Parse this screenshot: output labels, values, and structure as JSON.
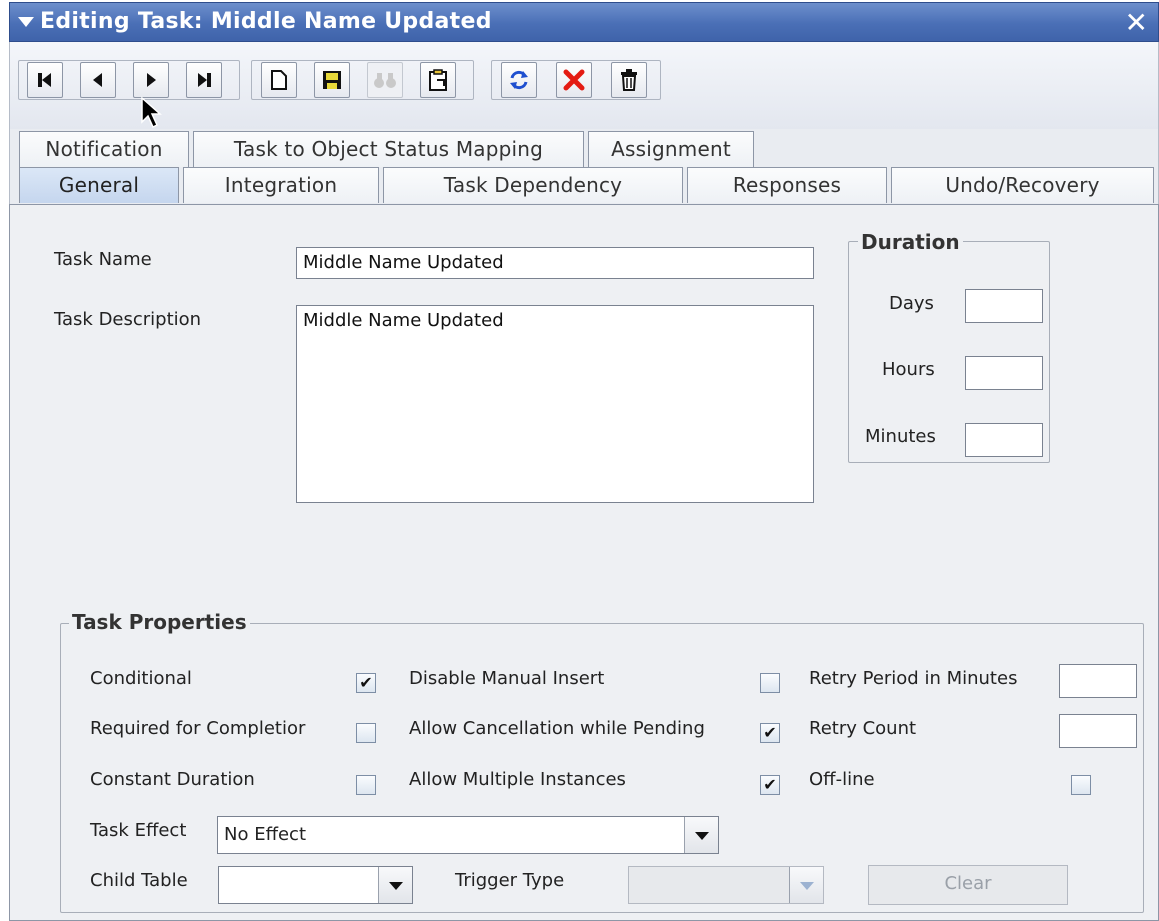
{
  "window": {
    "title": "Editing Task: Middle Name Updated"
  },
  "toolbar": {
    "buttons": [
      "first-record",
      "previous-record",
      "next-record",
      "last-record",
      "new",
      "save",
      "find",
      "query",
      "refresh",
      "delete-x",
      "trash"
    ]
  },
  "tabs_row1": [
    "Notification",
    "Task to Object Status Mapping",
    "Assignment"
  ],
  "tabs_row2": [
    "General",
    "Integration",
    "Task Dependency",
    "Responses",
    "Undo/Recovery"
  ],
  "general": {
    "task_name_label": "Task Name",
    "task_name_value": "Middle Name Updated",
    "task_description_label": "Task Description",
    "task_description_value": "Middle Name Updated"
  },
  "duration": {
    "legend": "Duration",
    "days_label": "Days",
    "hours_label": "Hours",
    "minutes_label": "Minutes",
    "days_value": "",
    "hours_value": "",
    "minutes_value": ""
  },
  "task_properties": {
    "legend": "Task Properties",
    "conditional_label": "Conditional",
    "conditional_checked": true,
    "required_label": "Required for Completior",
    "required_checked": false,
    "constant_label": "Constant Duration",
    "constant_checked": false,
    "disable_manual_label": "Disable Manual Insert",
    "disable_manual_checked": false,
    "allow_cancel_label": "Allow Cancellation while Pending",
    "allow_cancel_checked": true,
    "allow_multiple_label": "Allow Multiple Instances",
    "allow_multiple_checked": true,
    "retry_period_label": "Retry Period in Minutes",
    "retry_period_value": "",
    "retry_count_label": "Retry Count",
    "retry_count_value": "",
    "offline_label": "Off-line",
    "offline_checked": false,
    "task_effect_label": "Task Effect",
    "task_effect_value": "No Effect",
    "child_table_label": "Child Table",
    "child_table_value": "",
    "trigger_type_label": "Trigger Type",
    "trigger_type_value": "",
    "clear_label": "Clear"
  },
  "check_mark": "✔"
}
